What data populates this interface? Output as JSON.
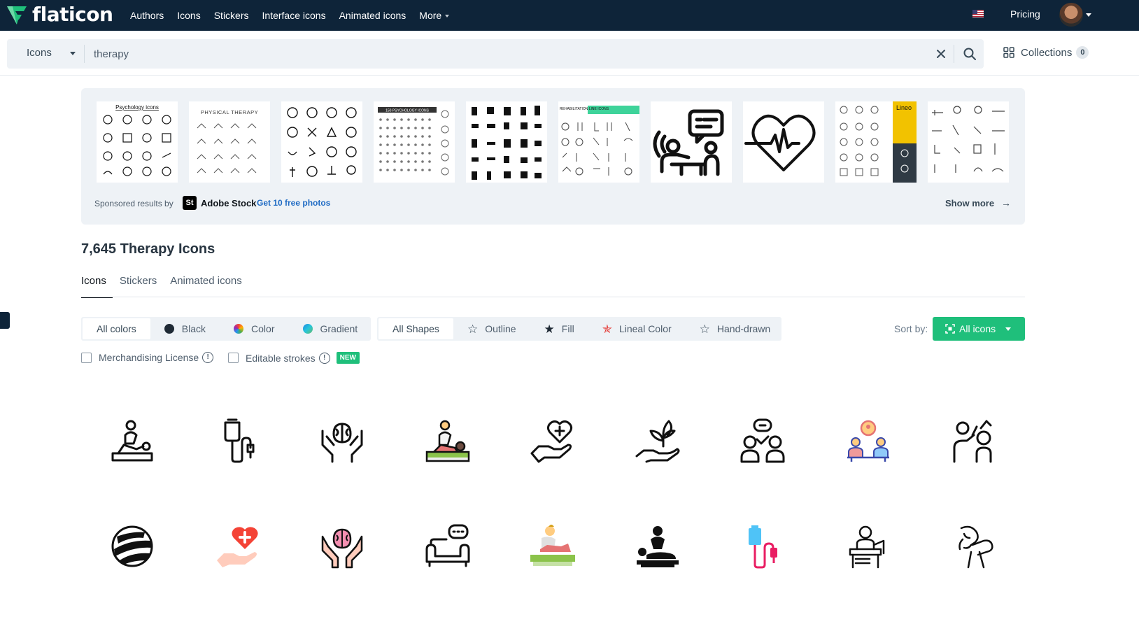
{
  "brand": {
    "name": "flaticon",
    "accent": "#1fbf7b",
    "nav_bg": "#0e2439"
  },
  "nav": {
    "links": [
      "Authors",
      "Icons",
      "Stickers",
      "Interface icons",
      "Animated icons",
      "More"
    ],
    "flag_icon": "us-flag-icon",
    "pricing": "Pricing"
  },
  "search": {
    "type": "Icons",
    "query": "therapy",
    "collections_label": "Collections",
    "collections_count": "0"
  },
  "sponsored": {
    "thumb_titles": [
      "Psychology icons",
      "PHYSICAL THERAPY",
      "150 PSYCHOLOGY ICONS",
      "REHABILITATION LINE ICONS",
      "Lineo"
    ],
    "label": "Sponsored results by",
    "provider_logo": "St",
    "provider": "Adobe Stock",
    "promo": "Get 10 free photos",
    "show_more": "Show more"
  },
  "results": {
    "title": "7,645 Therapy Icons",
    "tabs": [
      "Icons",
      "Stickers",
      "Animated icons"
    ],
    "active_tab": "Icons"
  },
  "filters": {
    "colors": [
      "All colors",
      "Black",
      "Color",
      "Gradient"
    ],
    "shapes": [
      "All Shapes",
      "Outline",
      "Fill",
      "Lineal Color",
      "Hand-drawn"
    ],
    "sort_label": "Sort by:",
    "sort_value": "All icons",
    "merch_license": "Merchandising License",
    "editable_strokes": "Editable strokes",
    "new_badge": "NEW"
  },
  "icons_row1": [
    "massage-therapy-icon",
    "iv-drip-icon",
    "brain-care-hands-icon",
    "massage-color-icon",
    "heart-care-hand-icon",
    "plant-growth-hand-icon",
    "counseling-icon",
    "therapy-session-color-icon",
    "physio-treatment-icon"
  ],
  "icons_row2": [
    "ball-icon",
    "heart-hand-color-icon",
    "brain-hands-color-icon",
    "sofa-therapy-icon",
    "massage-color-2-icon",
    "massage-glyph-icon",
    "iv-drip-color-icon",
    "therapist-desk-icon",
    "neck-pain-icon"
  ]
}
